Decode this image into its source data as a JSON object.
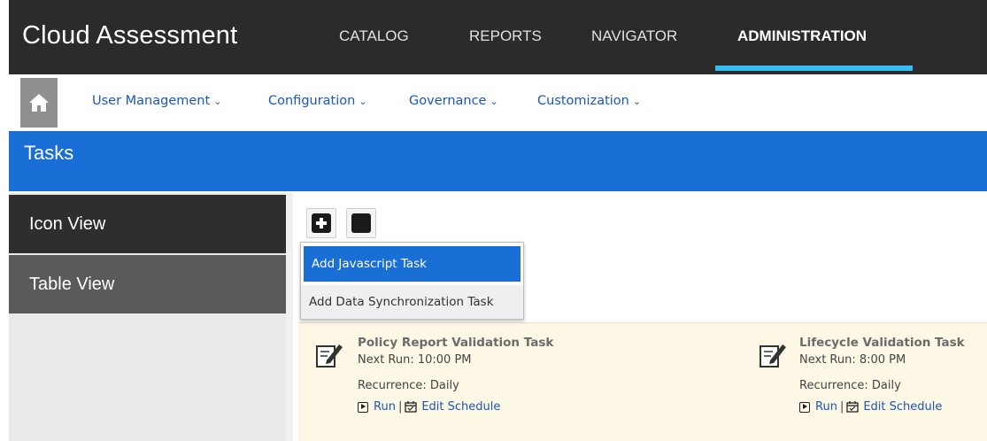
{
  "app": {
    "title": "Cloud Assessment"
  },
  "top_nav": {
    "items": [
      {
        "label": "CATALOG"
      },
      {
        "label": "REPORTS"
      },
      {
        "label": "NAVIGATOR"
      },
      {
        "label": "ADMINISTRATION",
        "active": true
      }
    ],
    "active_underline_color": "#33bff0"
  },
  "sub_nav": {
    "home_icon": "home-icon",
    "items": [
      {
        "label": "User Management"
      },
      {
        "label": "Configuration"
      },
      {
        "label": "Governance"
      },
      {
        "label": "Customization"
      }
    ],
    "chevron": "⌄"
  },
  "page": {
    "title": "Tasks",
    "header_color": "#1a6fd6"
  },
  "side_nav": {
    "items": [
      {
        "label": "Icon View"
      },
      {
        "label": "Table View"
      }
    ]
  },
  "toolbar": {
    "add_icon": "plus-square-icon",
    "stop_icon": "square-icon"
  },
  "dropdown": {
    "items": [
      {
        "label": "Add Javascript Task",
        "selected": true
      },
      {
        "label": "Add Data Synchronization Task"
      }
    ]
  },
  "tasks": [
    {
      "name": "Policy Report Validation Task",
      "next_run": "Next Run: 10:00 PM",
      "recurrence": "Recurrence: Daily",
      "run_label": "Run",
      "separator": "|",
      "edit_label": "Edit Schedule"
    },
    {
      "name": "Lifecycle Validation Task",
      "next_run": "Next Run: 8:00 PM",
      "recurrence": "Recurrence: Daily",
      "run_label": "Run",
      "separator": "|",
      "edit_label": "Edit Schedule"
    }
  ]
}
